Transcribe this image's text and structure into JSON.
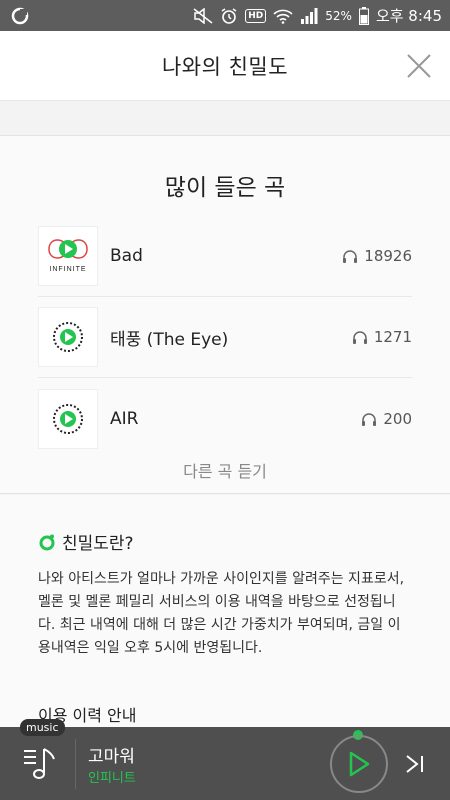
{
  "status_bar": {
    "left_icon": "app-notification-icon",
    "battery_percent": "52%",
    "time": "오후 8:45",
    "hd_label": "HD"
  },
  "header": {
    "title": "나와의 친밀도",
    "close_icon": "close-icon"
  },
  "top_songs": {
    "title": "많이 들은 곡",
    "more_label": "다른 곡 듣기",
    "items": [
      {
        "title": "Bad",
        "count": "18926",
        "art_label": "INFINITE"
      },
      {
        "title": "태풍 (The Eye)",
        "count": "1271"
      },
      {
        "title": "AIR",
        "count": "200"
      }
    ]
  },
  "info": {
    "heading": "친밀도란?",
    "body": "나와 아티스트가 얼마나 가까운 사이인지를 알려주는 지표로서, 멜론 및 멜론 페밀리 서비스의 이용 내역을 바탕으로 선정됩니다. 최근 내역에 대해 더 많은 시간 가중치가 부여되며, 금일 이용내역은 익일 오후 5시에 반영됩니다.",
    "sub_heading": "이용 이력 안내"
  },
  "player": {
    "badge": "music",
    "track_title": "고마워",
    "artist": "인피니트"
  },
  "colors": {
    "accent_green": "#24c450",
    "player_bg": "#4f4f4f",
    "status_bg": "#5d5d5d"
  }
}
